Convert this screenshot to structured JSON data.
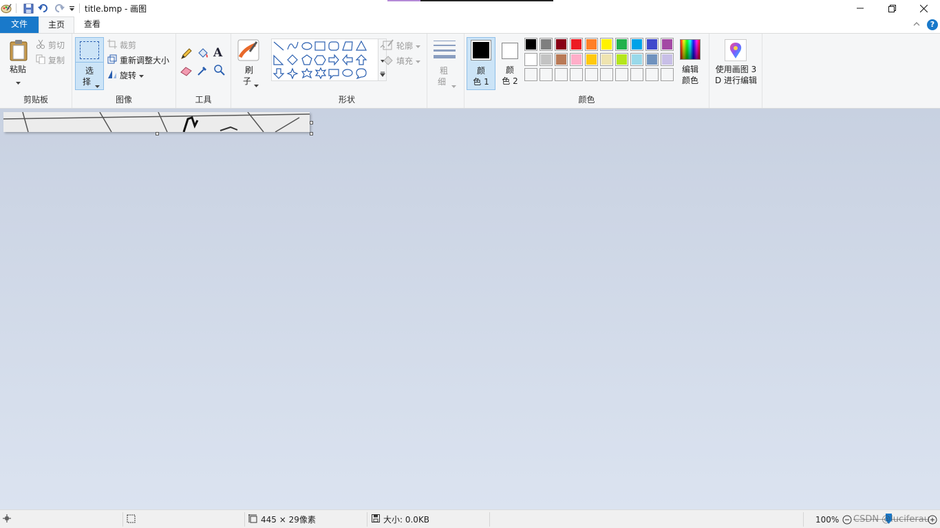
{
  "window": {
    "title": "title.bmp - 画图",
    "minimize_icon": "minimize-icon",
    "maximize_icon": "restore-icon",
    "close_icon": "close-icon"
  },
  "quick_access": [
    "paint-app-icon",
    "save-icon",
    "undo-icon",
    "redo-icon",
    "customize-dropdown-icon"
  ],
  "tabs": {
    "file": "文件",
    "home": "主页",
    "view": "查看"
  },
  "ribbon": {
    "clipboard": {
      "paste": "粘贴",
      "cut": "剪切",
      "copy": "复制",
      "label": "剪贴板"
    },
    "image": {
      "select_1": "选",
      "select_2": "择",
      "crop": "裁剪",
      "resize": "重新调整大小",
      "rotate": "旋转",
      "label": "图像"
    },
    "tools": {
      "label": "工具"
    },
    "brushes": {
      "label_1": "刷",
      "label_2": "子"
    },
    "shapes": {
      "outline": "轮廓",
      "fill": "填充",
      "label": "形状"
    },
    "size": {
      "label_1": "粗",
      "label_2": "细"
    },
    "colors": {
      "color1_a": "颜",
      "color1_b": "色 1",
      "color2_a": "颜",
      "color2_b": "色 2",
      "edit_a": "编辑",
      "edit_b": "颜色",
      "label": "颜色",
      "palette": [
        "#000000",
        "#7f7f7f",
        "#880015",
        "#ed1c24",
        "#ff7f27",
        "#fff200",
        "#22b14c",
        "#00a2e8",
        "#3f48cc",
        "#a349a4",
        "#ffffff",
        "#c3c3c3",
        "#b97a57",
        "#ffaec9",
        "#ffc90e",
        "#efe4b0",
        "#b5e61d",
        "#99d9ea",
        "#7092be",
        "#c8bfe7",
        "#f5f6f7",
        "#f5f6f7",
        "#f5f6f7",
        "#f5f6f7",
        "#f5f6f7",
        "#f5f6f7",
        "#f5f6f7",
        "#f5f6f7",
        "#f5f6f7",
        "#f5f6f7"
      ],
      "color1": "#000000",
      "color2": "#ffffff"
    },
    "paint3d": {
      "line1": "使用画图 3",
      "line2": "D 进行编辑"
    }
  },
  "statusbar": {
    "dimensions": "445 × 29像素",
    "file_size": "大小: 0.0KB",
    "zoom": "100%",
    "watermark": "CSDN @luciferau"
  }
}
